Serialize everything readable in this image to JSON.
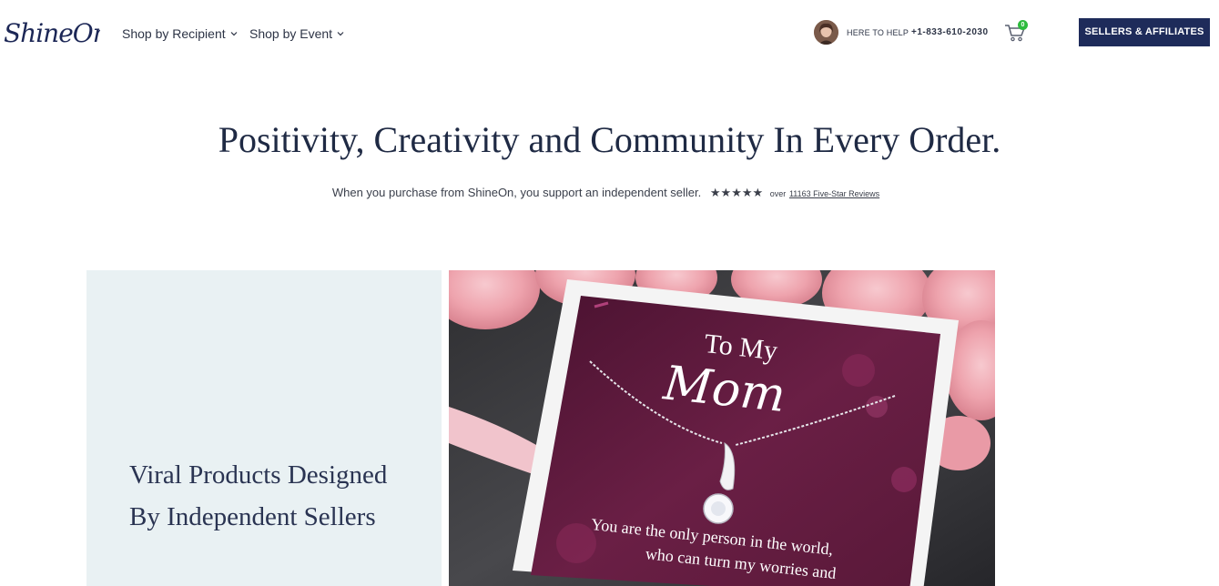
{
  "header": {
    "logo_text": "ShineOn",
    "nav": [
      {
        "label": "Shop by Recipient"
      },
      {
        "label": "Shop by Event"
      }
    ],
    "help_label": "HERE TO HELP",
    "phone": "+1-833-610-2030",
    "cart_count": "0",
    "sellers_button": "SELLERS & AFFILIATES"
  },
  "hero": {
    "title": "Positivity, Creativity and Community In Every Order.",
    "subline": "When you purchase from ShineOn, you support an independent seller.",
    "stars": "★★★★★",
    "rating": 5,
    "reviews_prefix": "over",
    "reviews_link": "11163 Five-Star Reviews"
  },
  "feature": {
    "headline_line1": "Viral Products Designed",
    "headline_line2": "By Independent Sellers",
    "image": {
      "card_title": "To My",
      "card_script": "Mom",
      "card_message_line1": "You are the only person in the world,",
      "card_message_line2": "who can turn my worries and"
    }
  },
  "colors": {
    "navy": "#1e2b5a",
    "panel": "#e9f1f3",
    "cart_badge": "#2dbb3d",
    "card": "#5a1a3a"
  }
}
